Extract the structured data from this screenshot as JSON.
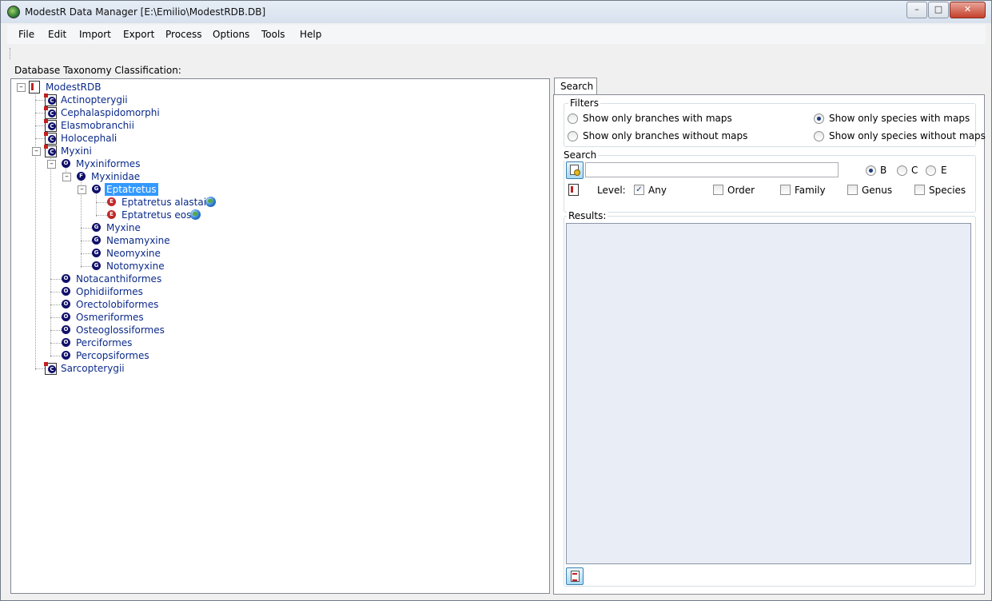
{
  "window": {
    "title": "ModestR Data Manager [E:\\Emilio\\ModestRDB.DB]",
    "controls": {
      "minimize": "–",
      "maximize": "□",
      "close": "✕"
    }
  },
  "menu": [
    "File",
    "Edit",
    "Import",
    "Export",
    "Process",
    "Options",
    "Tools",
    "Help"
  ],
  "tree": {
    "heading": "Database Taxonomy Classification:",
    "root": "ModestRDB",
    "classes_before": [
      "Actinopterygii",
      "Cephalaspidomorphi",
      "Elasmobranchii",
      "Holocephali"
    ],
    "open_class": "Myxini",
    "open_order": "Myxiniformes",
    "open_family": "Myxinidae",
    "selected_genus": "Eptatretus",
    "species": [
      "Eptatretus alastairi",
      "Eptatretus eos"
    ],
    "other_genera": [
      "Myxine",
      "Nemamyxine",
      "Neomyxine",
      "Notomyxine"
    ],
    "other_orders": [
      "Notacanthiformes",
      "Ophidiiformes",
      "Orectolobiformes",
      "Osmeriformes",
      "Osteoglossiformes",
      "Perciformes",
      "Percopsiformes"
    ],
    "classes_after": [
      "Sarcopterygii"
    ],
    "badges": {
      "class": "C",
      "order": "O",
      "family": "F",
      "genus": "G",
      "species": "E"
    },
    "expander": "–"
  },
  "search_panel": {
    "tab": "Search",
    "filters": {
      "title": "Filters",
      "branches_with_maps": "Show only branches with maps",
      "branches_without_maps": "Show only branches without maps",
      "species_with_maps": "Show only species with maps",
      "species_without_maps": "Show only species without maps"
    },
    "search": {
      "title": "Search",
      "query": "",
      "mode_b": "B",
      "mode_c": "C",
      "mode_e": "E",
      "level_label": "Level:",
      "levels": {
        "any": "Any",
        "order": "Order",
        "family": "Family",
        "genus": "Genus",
        "species": "Species"
      },
      "any_mark": "✓"
    },
    "results_label": "Results:"
  }
}
